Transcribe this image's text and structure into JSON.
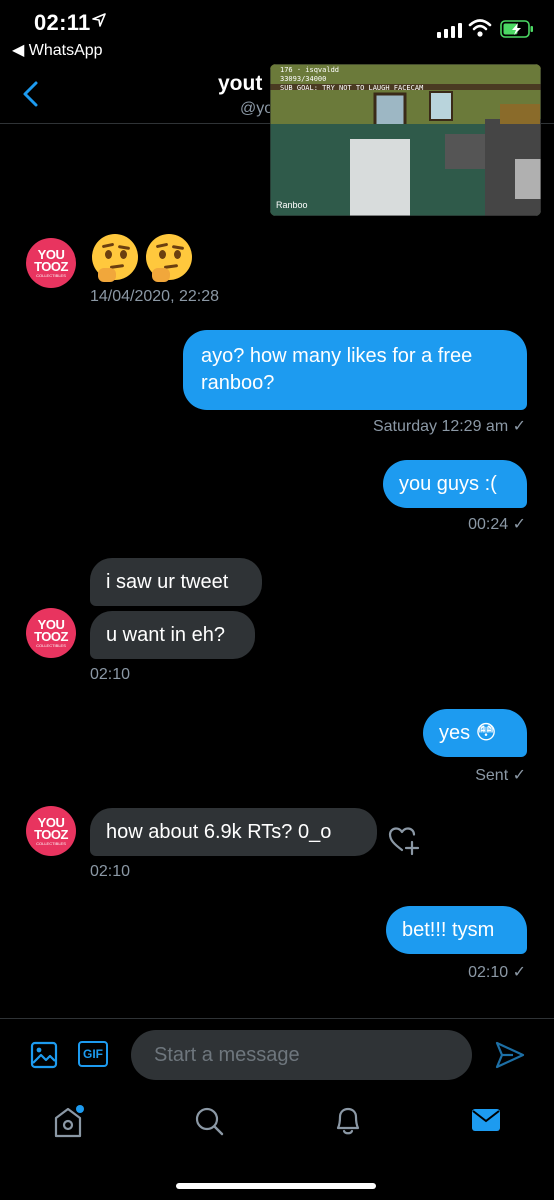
{
  "status_bar": {
    "time": "02:11",
    "back_app": "◀ WhatsApp"
  },
  "header": {
    "name": "yout",
    "handle": "@yo"
  },
  "pip": {
    "overlay_line1": "176 · isqvaldd",
    "overlay_line2": "33093/34000",
    "overlay_line3": "SUB GOAL: TRY NOT TO LAUGH FACECAM",
    "streamer": "Ranboo"
  },
  "avatar": {
    "line1": "YOU",
    "line2": "TOOZ",
    "line3": "COLLECTIBLES"
  },
  "messages": [
    {
      "id": "m1",
      "direction": "in",
      "text": "",
      "emoji": [
        "thinking-face",
        "thinking-face"
      ],
      "meta": "14/04/2020, 22:28"
    },
    {
      "id": "m2",
      "direction": "out",
      "text": "ayo? how many likes for a free ranboo?",
      "meta": "Saturday 12:29 am ✓"
    },
    {
      "id": "m3",
      "direction": "out",
      "text": "you guys :(",
      "meta": "00:24 ✓"
    },
    {
      "id": "m4",
      "direction": "in",
      "text": "i saw ur tweet"
    },
    {
      "id": "m5",
      "direction": "in",
      "text": "u want in eh?",
      "meta": "02:10"
    },
    {
      "id": "m6",
      "direction": "out",
      "text": "yes 😳",
      "meta": "Sent ✓"
    },
    {
      "id": "m7",
      "direction": "in",
      "text": "how about 6.9k RTs? 0_o",
      "meta": "02:10"
    },
    {
      "id": "m8",
      "direction": "out",
      "text": "bet!!! tysm",
      "meta": "02:10 ✓"
    }
  ],
  "composer": {
    "gif_label": "GIF",
    "placeholder": "Start a message"
  },
  "colors": {
    "accent": "#1d9bf0",
    "incoming_bubble": "#2f3336",
    "avatar_brand": "#e8345f",
    "muted_text": "#8b98a5"
  },
  "icons": {
    "back": "chevron-left-icon",
    "image": "image-icon",
    "gif": "gif-icon",
    "send": "send-icon",
    "home": "home-icon",
    "search": "search-icon",
    "notifications": "bell-icon",
    "messages": "mail-icon",
    "react": "heart-plus-icon"
  }
}
